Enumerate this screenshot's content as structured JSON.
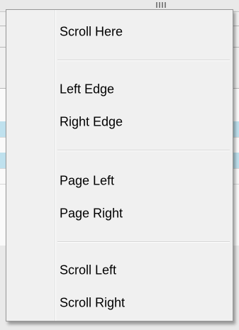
{
  "menu": {
    "items": [
      {
        "label": "Scroll Here"
      },
      {
        "label": "Left Edge"
      },
      {
        "label": "Right Edge"
      },
      {
        "label": "Page Left"
      },
      {
        "label": "Page Right"
      },
      {
        "label": "Scroll Left"
      },
      {
        "label": "Scroll Right"
      }
    ]
  },
  "colors": {
    "menu_background": "#f0f0f0",
    "menu_border": "#979797",
    "separator": "#d7d7d7",
    "row_highlight": "#bfe1ee"
  }
}
